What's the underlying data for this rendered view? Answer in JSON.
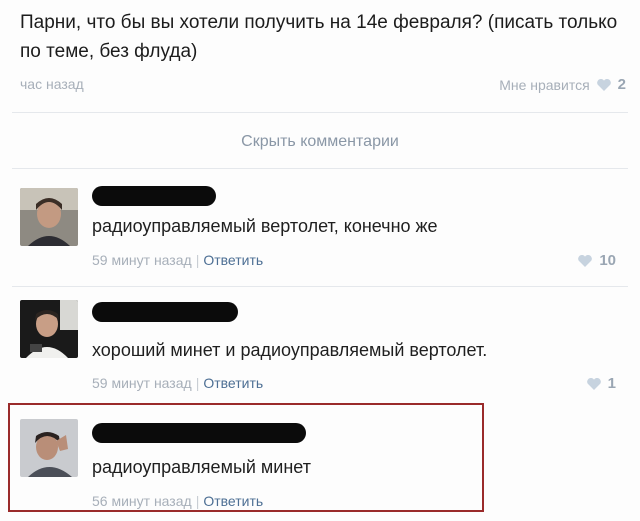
{
  "post": {
    "text": "Парни, что бы вы хотели получить на 14е февраля? (писать только по теме, без флуда)",
    "time": "час назад",
    "like_label": "Мне нравится",
    "like_count": "2",
    "heart_icon": "heart-icon"
  },
  "hide_comments": "Скрыть комментарии",
  "comments": [
    {
      "text": "радиоуправляемый вертолет, конечно же",
      "time": "59 минут назад",
      "sep": "|",
      "reply": "Ответить",
      "likes": "10"
    },
    {
      "text": "хороший минет и радиоуправляемый вертолет.",
      "time": "59 минут назад",
      "sep": "|",
      "reply": "Ответить",
      "likes": "1"
    },
    {
      "text": "радиоуправляемый минет",
      "time": "56 минут назад",
      "sep": "|",
      "reply": "Ответить",
      "likes": ""
    }
  ],
  "colors": {
    "highlight_border": "#9a2a2a",
    "link": "#4d6f94",
    "muted": "#a7afb9",
    "heart": "#c7d3df"
  }
}
